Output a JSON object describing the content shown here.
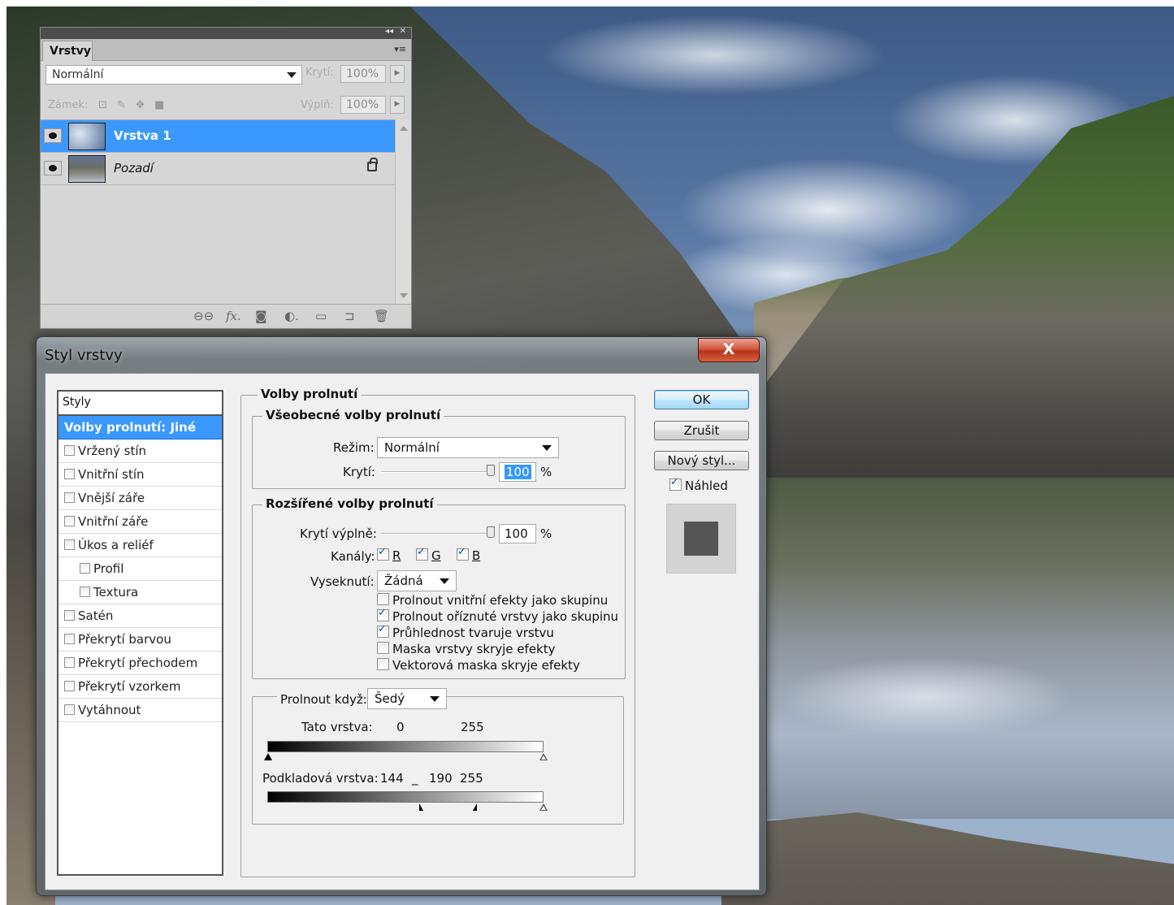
{
  "layers_panel": {
    "tab_title": "Vrstvy",
    "blend_mode": "Normální",
    "opacity_label": "Krytí:",
    "opacity_value": "100%",
    "lock_label": "Zámek:",
    "fill_label": "Výplň:",
    "fill_value": "100%",
    "layers": [
      {
        "name": "Vrstva 1",
        "selected": true,
        "thumbnail": "clouds"
      },
      {
        "name": "Pozadí",
        "selected": false,
        "thumbnail": "landscape",
        "locked": true
      }
    ],
    "footer_icons": [
      "link-icon",
      "fx-icon",
      "mask-icon",
      "adjustment-icon",
      "folder-icon",
      "new-layer-icon",
      "trash-icon"
    ]
  },
  "dialog": {
    "title": "Styl vrstvy",
    "close_label": "X",
    "styles_header": "Styly",
    "styles": [
      {
        "label": "Volby prolnutí: Jiné",
        "active": true,
        "checkbox": false,
        "indent": false
      },
      {
        "label": "Vržený stín",
        "checkbox": true,
        "checked": false,
        "indent": false
      },
      {
        "label": "Vnitřní stín",
        "checkbox": true,
        "checked": false,
        "indent": false
      },
      {
        "label": "Vnější záře",
        "checkbox": true,
        "checked": false,
        "indent": false
      },
      {
        "label": "Vnitřní záře",
        "checkbox": true,
        "checked": false,
        "indent": false
      },
      {
        "label": "Úkos a reliéf",
        "checkbox": true,
        "checked": false,
        "indent": false
      },
      {
        "label": "Profil",
        "checkbox": true,
        "checked": false,
        "indent": true
      },
      {
        "label": "Textura",
        "checkbox": true,
        "checked": false,
        "indent": true
      },
      {
        "label": "Satén",
        "checkbox": true,
        "checked": false,
        "indent": false
      },
      {
        "label": "Překrytí barvou",
        "checkbox": true,
        "checked": false,
        "indent": false
      },
      {
        "label": "Překrytí přechodem",
        "checkbox": true,
        "checked": false,
        "indent": false
      },
      {
        "label": "Překrytí vzorkem",
        "checkbox": true,
        "checked": false,
        "indent": false
      },
      {
        "label": "Vytáhnout",
        "checkbox": true,
        "checked": false,
        "indent": false
      }
    ],
    "blending": {
      "section_title": "Volby prolnutí",
      "general": {
        "title": "Všeobecné volby prolnutí",
        "mode_label": "Režim:",
        "mode_value": "Normální",
        "opacity_label": "Krytí:",
        "opacity_value": "100",
        "opacity_unit": "%",
        "opacity_fraction": 1.0
      },
      "advanced": {
        "title": "Rozšířené volby prolnutí",
        "fill_label": "Krytí výplně:",
        "fill_value": "100",
        "fill_unit": "%",
        "fill_fraction": 1.0,
        "channels_label": "Kanály:",
        "channels": [
          {
            "label": "R",
            "checked": true
          },
          {
            "label": "G",
            "checked": true
          },
          {
            "label": "B",
            "checked": true
          }
        ],
        "knockout_label": "Vyseknutí:",
        "knockout_value": "Žádná",
        "options": [
          {
            "label": "Prolnout vnitřní efekty jako skupinu",
            "checked": false
          },
          {
            "label": "Prolnout oříznuté vrstvy jako skupinu",
            "checked": true
          },
          {
            "label": "Průhlednost tvaruje vrstvu",
            "checked": true
          },
          {
            "label": "Maska vrstvy skryje efekty",
            "checked": false
          },
          {
            "label": "Vektorová maska skryje efekty",
            "checked": false
          }
        ]
      },
      "blend_if": {
        "label": "Prolnout když:",
        "value": "Šedý",
        "this_layer_label": "Tato vrstva:",
        "this_layer_low": "0",
        "this_layer_high": "255",
        "underlying_label": "Podkladová vrstva:",
        "underlying_low": "144",
        "underlying_sep": "_",
        "underlying_mid": "190",
        "underlying_high": "255"
      }
    },
    "buttons": {
      "ok": "OK",
      "cancel": "Zrušit",
      "new_style": "Nový styl...",
      "preview_label": "Náhled",
      "preview_checked": true
    }
  }
}
